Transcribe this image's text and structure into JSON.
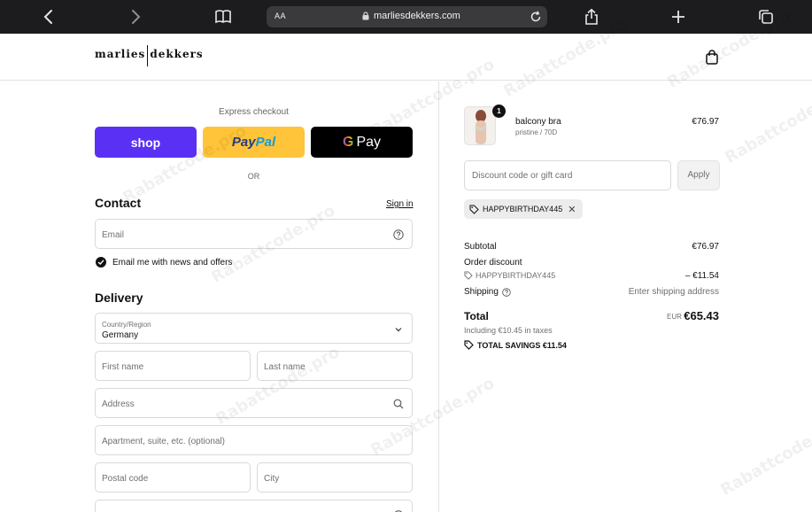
{
  "browser": {
    "text_size_label": "AA",
    "url": "marliesdekkers.com"
  },
  "header": {
    "logo_left": "marlies",
    "logo_right": "dekkers"
  },
  "express": {
    "label": "Express checkout",
    "shop_label": "shop",
    "paypal_part1": "Pay",
    "paypal_part2": "Pal",
    "gpay_g": "G",
    "gpay_label": "Pay",
    "or_label": "OR"
  },
  "contact": {
    "title": "Contact",
    "signin_label": "Sign in",
    "email_placeholder": "Email",
    "newsletter_label": "Email me with news and offers",
    "newsletter_checked": true
  },
  "delivery": {
    "title": "Delivery",
    "country_label": "Country/Region",
    "country_value": "Germany",
    "first_name_placeholder": "First name",
    "last_name_placeholder": "Last name",
    "address_placeholder": "Address",
    "apartment_placeholder": "Apartment, suite, etc. (optional)",
    "postal_placeholder": "Postal code",
    "city_placeholder": "City"
  },
  "order": {
    "item": {
      "quantity": "1",
      "name": "balcony bra",
      "variant": "pristine / 70D",
      "price": "€76.97"
    },
    "discount_placeholder": "Discount code or gift card",
    "apply_label": "Apply",
    "applied_code": "HAPPYBIRTHDAY445",
    "subtotal_label": "Subtotal",
    "subtotal_value": "€76.97",
    "order_discount_label": "Order discount",
    "discount_code": "HAPPYBIRTHDAY445",
    "discount_value": "– €11.54",
    "shipping_label": "Shipping",
    "shipping_value": "Enter shipping address",
    "total_label": "Total",
    "total_currency": "EUR",
    "total_value": "€65.43",
    "taxes_note": "Including €10.45 in taxes",
    "savings_label": "TOTAL SAVINGS",
    "savings_value": "€11.54"
  },
  "watermark": "Rabattcode.pro",
  "colors": {
    "shop": "#5a31f4",
    "paypal": "#ffc439",
    "gpay": "#000000",
    "chrome": "#1c1c1e"
  }
}
